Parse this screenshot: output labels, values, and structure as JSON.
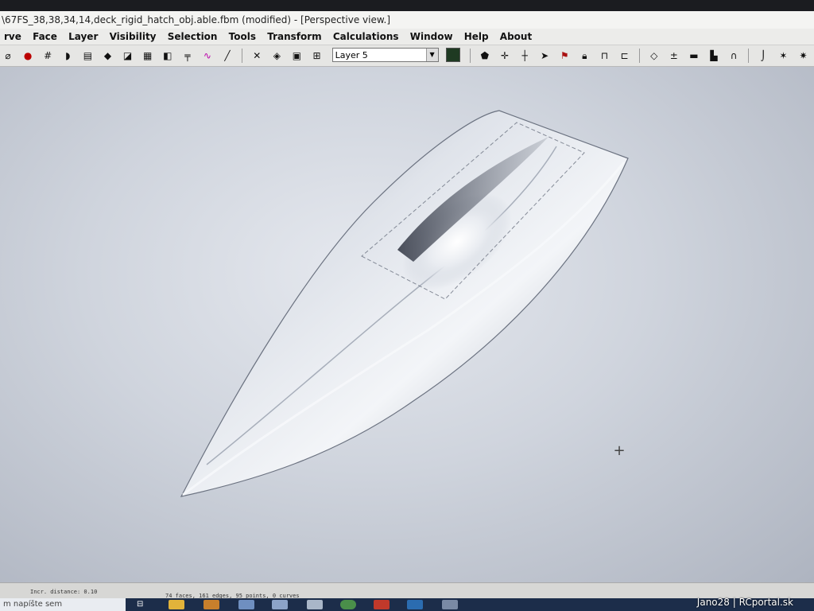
{
  "window": {
    "title": "\\67FS_38,38,34,14,deck_rigid_hatch_obj.able.fbm (modified) - [Perspective view.]"
  },
  "menu": [
    "rve",
    "Face",
    "Layer",
    "Visibility",
    "Selection",
    "Tools",
    "Transform",
    "Calculations",
    "Window",
    "Help",
    "About"
  ],
  "toolbar": {
    "layer_value": "Layer 5",
    "icons": [
      "lasso-icon",
      "record-icon",
      "grid-icon",
      "hull-icon",
      "frame-icon",
      "shade-icon",
      "curvature-icon",
      "section-icon",
      "box-icon",
      "stations-icon",
      "curve-icon",
      "line-icon",
      "fit-icon",
      "layers-icon",
      "display-icon",
      "properties-icon",
      "pin-icon",
      "move-icon",
      "split-icon",
      "knuckle-icon",
      "flag-icon",
      "lock-icon",
      "unlock-icon",
      "insert-icon",
      "diamond-icon",
      "axis-icon",
      "flip-icon",
      "book-icon",
      "arch-icon",
      "spline-icon",
      "star-icon",
      "sparkle-icon",
      "tee-icon"
    ],
    "color_value": "#1f3a22"
  },
  "viewport": {
    "label": "Perspective view.",
    "hull_color": "#c7ccd6"
  },
  "status": {
    "left": "Incr. distance: 0.10",
    "middle": "74 faces, 161 edges, 95 points, 0 curves"
  },
  "taskbar": {
    "search_placeholder": "m napíšte sem"
  },
  "watermark": "Jano28 | RCportal.sk"
}
